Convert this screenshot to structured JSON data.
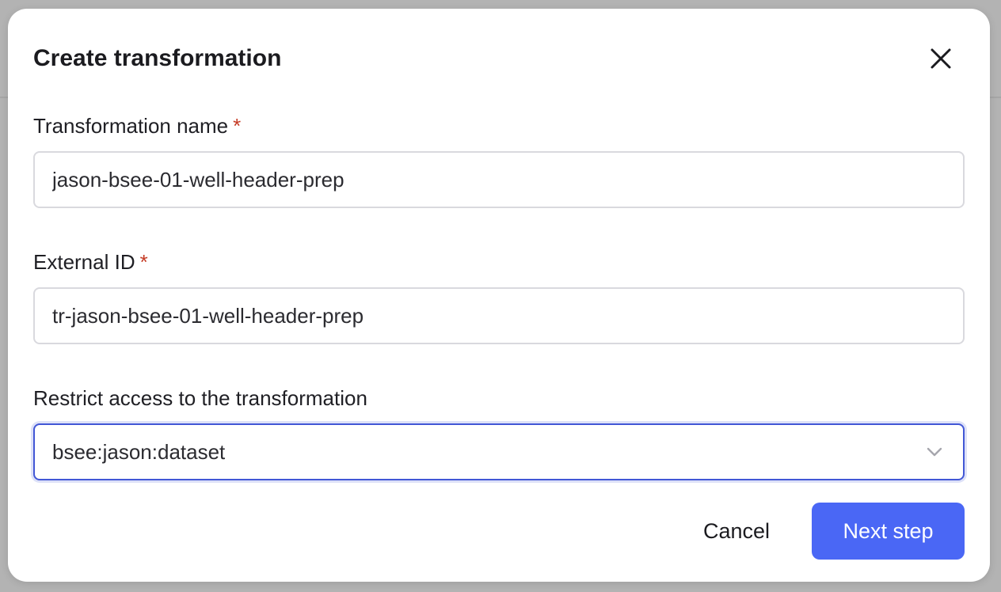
{
  "dialog": {
    "title": "Create transformation",
    "close_icon": "close-icon"
  },
  "fields": {
    "name": {
      "label": "Transformation name",
      "required_marker": "*",
      "value": "jason-bsee-01-well-header-prep"
    },
    "external_id": {
      "label": "External ID",
      "required_marker": "*",
      "value": "tr-jason-bsee-01-well-header-prep"
    },
    "access": {
      "label": "Restrict access to the transformation",
      "selected": "bsee:jason:dataset",
      "chevron_icon": "chevron-down-icon"
    }
  },
  "actions": {
    "cancel_label": "Cancel",
    "next_label": "Next step"
  },
  "colors": {
    "primary": "#4a67f5",
    "focus_border": "#4257d6",
    "required": "#c53b25",
    "backdrop": "#b3b3b3"
  }
}
